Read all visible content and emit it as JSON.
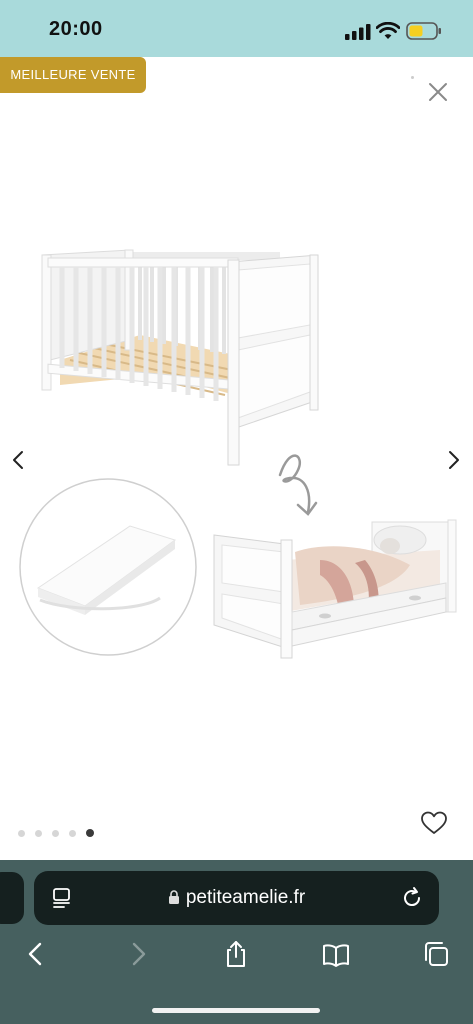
{
  "status_bar": {
    "time": "20:00"
  },
  "product": {
    "badge": "MEILLEURE VENTE",
    "gallery": {
      "image_count": 5,
      "active_index": 4
    }
  },
  "browser": {
    "url": "petiteamelie.fr"
  },
  "colors": {
    "status_bg": "#a9dadb",
    "badge_bg": "#c29a2a",
    "browser_bg": "#46605f",
    "urlbar_bg": "#15201f",
    "battery_fill": "#f6cf20"
  },
  "icons": {
    "close": "close-icon",
    "prev": "chevron-left-icon",
    "next": "chevron-right-icon",
    "favorite": "heart-icon",
    "share": "share-icon",
    "bookmarks": "book-icon",
    "tabs": "tabs-icon",
    "reload": "reload-icon",
    "reader": "reader-icon"
  }
}
